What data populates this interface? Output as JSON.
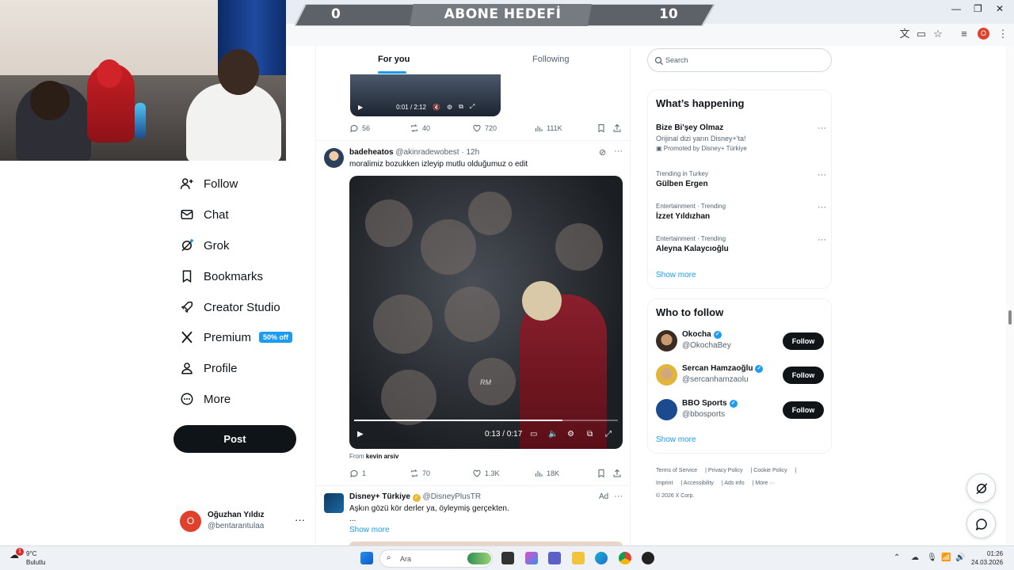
{
  "overlay": {
    "left_count": "0",
    "title": "ABONE HEDEFİ",
    "right_count": "10"
  },
  "browser": {
    "profile_initial": "O"
  },
  "nav": {
    "items": [
      {
        "id": "follow",
        "label": "Follow"
      },
      {
        "id": "chat",
        "label": "Chat"
      },
      {
        "id": "grok",
        "label": "Grok"
      },
      {
        "id": "bookmarks",
        "label": "Bookmarks"
      },
      {
        "id": "creator-studio",
        "label": "Creator Studio"
      },
      {
        "id": "premium",
        "label": "Premium",
        "badge": "50% off"
      },
      {
        "id": "profile",
        "label": "Profile"
      },
      {
        "id": "more",
        "label": "More"
      }
    ],
    "post_label": "Post",
    "account": {
      "initial": "O",
      "name": "Oğuzhan Yıldız",
      "handle": "@bentarantulaa",
      "more": "···"
    }
  },
  "timeline": {
    "tabs": {
      "for_you": "For you",
      "following": "Following"
    },
    "top_video": {
      "time": "0:01 / 2:12"
    },
    "top_actions": {
      "replies": "56",
      "reposts": "40",
      "likes": "720",
      "views": "111K"
    },
    "tweet": {
      "name": "badeheatos",
      "handle": "@akinradewobest",
      "time": "· 12h",
      "text": "moralimiz bozukken izleyip mutlu olduğumuz o edit",
      "video_time": "0:13 / 0:17",
      "video_progress": 0.79,
      "watermark": "RM",
      "from_prefix": "From",
      "from_name": "kevin arsiv",
      "actions": {
        "replies": "1",
        "reposts": "70",
        "likes": "1.3K",
        "views": "18K"
      }
    },
    "ad": {
      "name": "Disney+ Türkiye",
      "handle": "@DisneyPlusTR",
      "tag": "Ad",
      "text": "Aşkın gözü kör derler ya, öyleymiş gerçekten.",
      "ellipsis": "...",
      "show_more": "Show more"
    }
  },
  "sidebar": {
    "search_placeholder": "Search",
    "happening": {
      "title": "What’s happening",
      "items": [
        {
          "meta": "",
          "title": "Bize Bi'şey Olmaz",
          "sub": "Orijinal dizi yarın Disney+'ta!",
          "promo": "Promoted by Disney+ Türkiye"
        },
        {
          "meta": "Trending in Turkey",
          "title": "Gülben Ergen"
        },
        {
          "meta": "Entertainment · Trending",
          "title": "İzzet Yıldızhan"
        },
        {
          "meta": "Entertainment · Trending",
          "title": "Aleyna Kalaycıoğlu"
        }
      ],
      "show_more": "Show more"
    },
    "who_to_follow": {
      "title": "Who to follow",
      "users": [
        {
          "name": "Okocha",
          "handle": "@OkochaBey",
          "button": "Follow"
        },
        {
          "name": "Sercan Hamzaoğlu",
          "handle": "@sercanhamzaolu",
          "button": "Follow"
        },
        {
          "name": "BBO Sports",
          "handle": "@bbosports",
          "button": "Follow"
        }
      ],
      "show_more": "Show more"
    },
    "footer": {
      "links": [
        "Terms of Service",
        "Privacy Policy",
        "Cookie Policy",
        "Imprint",
        "Accessibility",
        "Ads info",
        "More ···"
      ],
      "copyright": "© 2026 X Corp."
    }
  },
  "taskbar": {
    "weather_temp": "9°C",
    "weather_desc": "Bulutlu",
    "weather_badge": "1",
    "search_placeholder": "Ara",
    "time": "01:26",
    "date": "24.03.2026"
  },
  "colors": {
    "accent": "#1d9bf0",
    "dark": "#0f1419",
    "muted": "#536471",
    "profile": "#e0412c"
  }
}
